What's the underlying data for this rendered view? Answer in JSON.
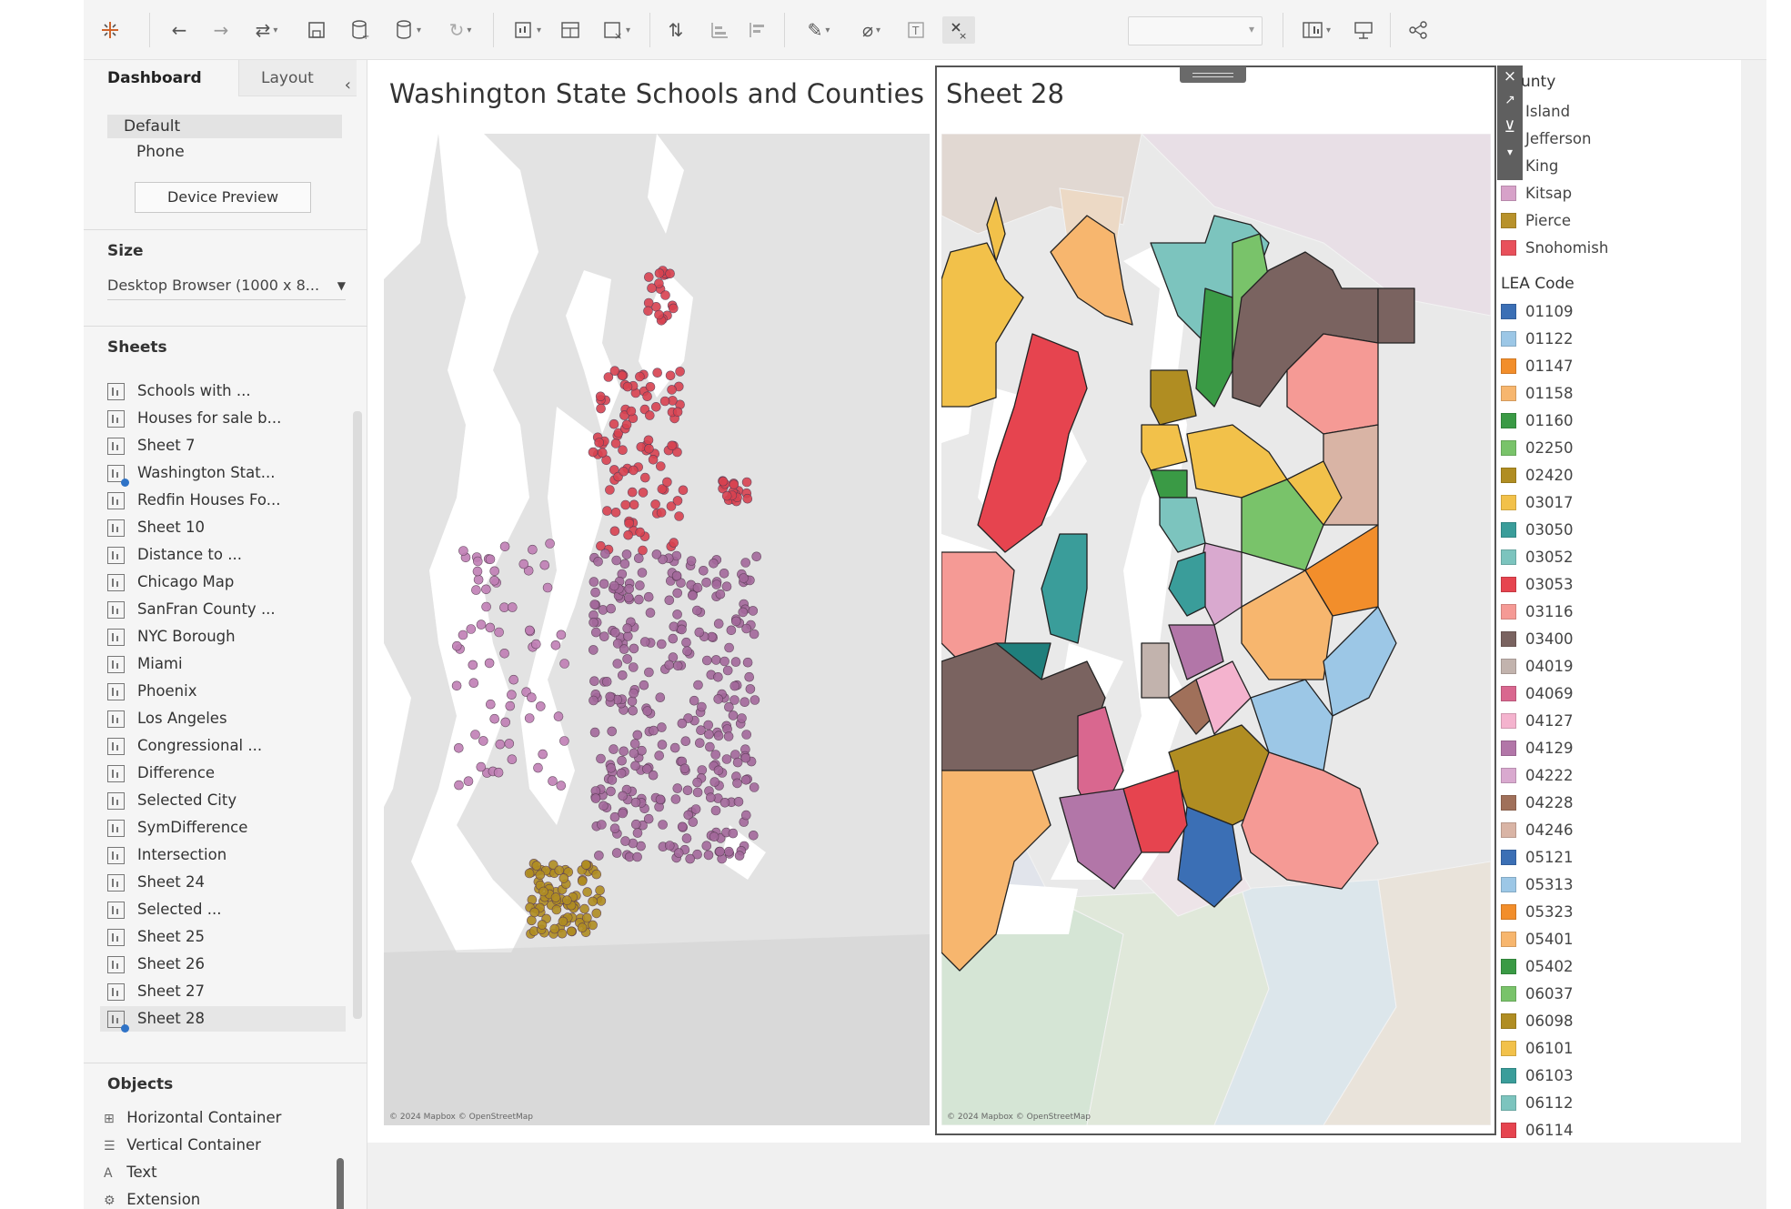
{
  "toolbar": {
    "icons": [
      "tableau-logo-icon",
      "undo-icon",
      "redo-icon",
      "swap-icon",
      "save-icon",
      "new-datasource-icon",
      "pause-updates-icon",
      "refresh-icon",
      "new-worksheet-icon",
      "new-dashboard-icon",
      "clear-sheet-icon",
      "swap-rows-columns-icon",
      "sort-ascending-icon",
      "sort-descending-icon",
      "highlight-icon",
      "group-icon",
      "show-labels-icon",
      "fix-axes-icon",
      "fit-dropdown",
      "show-cards-icon",
      "presentation-mode-icon",
      "share-icon"
    ]
  },
  "left_panel": {
    "tabs": {
      "dashboard": "Dashboard",
      "layout": "Layout"
    },
    "device_layouts": [
      "Default",
      "Phone"
    ],
    "device_preview_label": "Device Preview",
    "size": {
      "title": "Size",
      "value": "Desktop Browser (1000 x 8..."
    },
    "sheets_title": "Sheets",
    "sheets": [
      {
        "label": "Schools with ...",
        "on_dashboard": false
      },
      {
        "label": "Houses for sale b...",
        "on_dashboard": false
      },
      {
        "label": "Sheet 7",
        "on_dashboard": false
      },
      {
        "label": "Washington Stat...",
        "on_dashboard": true
      },
      {
        "label": "Redfin Houses Fo...",
        "on_dashboard": false
      },
      {
        "label": "Sheet 10",
        "on_dashboard": false
      },
      {
        "label": "Distance to ...",
        "on_dashboard": false
      },
      {
        "label": "Chicago Map",
        "on_dashboard": false
      },
      {
        "label": "SanFran County ...",
        "on_dashboard": false
      },
      {
        "label": "NYC Borough",
        "on_dashboard": false
      },
      {
        "label": "Miami",
        "on_dashboard": false
      },
      {
        "label": "Phoenix",
        "on_dashboard": false
      },
      {
        "label": "Los Angeles",
        "on_dashboard": false
      },
      {
        "label": "Congressional ...",
        "on_dashboard": false
      },
      {
        "label": "Difference",
        "on_dashboard": false
      },
      {
        "label": "Selected City",
        "on_dashboard": false
      },
      {
        "label": "SymDifference",
        "on_dashboard": false
      },
      {
        "label": "Intersection",
        "on_dashboard": false
      },
      {
        "label": "Sheet 24",
        "on_dashboard": false
      },
      {
        "label": "Selected ...",
        "on_dashboard": false
      },
      {
        "label": "Sheet 25",
        "on_dashboard": false
      },
      {
        "label": "Sheet 26",
        "on_dashboard": false
      },
      {
        "label": "Sheet 27",
        "on_dashboard": false
      },
      {
        "label": "Sheet 28",
        "on_dashboard": true
      }
    ],
    "objects_title": "Objects",
    "objects": [
      {
        "label": "Horizontal Container",
        "icon": "horizontal-container-icon"
      },
      {
        "label": "Vertical Container",
        "icon": "vertical-container-icon"
      },
      {
        "label": "Text",
        "icon": "text-icon"
      },
      {
        "label": "Extension",
        "icon": "extension-icon"
      }
    ]
  },
  "dashboard": {
    "sheet1_title": "Washington State Schools and Counties",
    "sheet2_title": "Sheet 28",
    "attribution": "© 2024 Mapbox © OpenStreetMap"
  },
  "legend": {
    "county_title": "unty",
    "county": [
      {
        "label": "Island",
        "color": ""
      },
      {
        "label": "Jefferson",
        "color": ""
      },
      {
        "label": "King",
        "color": ""
      },
      {
        "label": "Kitsap",
        "color": "#d7a2c9"
      },
      {
        "label": "Pierce",
        "color": "#b8922b"
      },
      {
        "label": "Snohomish",
        "color": "#e8505b"
      }
    ],
    "lea_title": "LEA Code",
    "lea": [
      {
        "label": "01109",
        "color": "#3b6fb5"
      },
      {
        "label": "01122",
        "color": "#9cc7e6"
      },
      {
        "label": "01147",
        "color": "#f28e2b"
      },
      {
        "label": "01158",
        "color": "#f7b66e"
      },
      {
        "label": "01160",
        "color": "#3a9a45"
      },
      {
        "label": "02250",
        "color": "#79c36a"
      },
      {
        "label": "02420",
        "color": "#b08d22"
      },
      {
        "label": "03017",
        "color": "#f2c14a"
      },
      {
        "label": "03050",
        "color": "#3a9d9a"
      },
      {
        "label": "03052",
        "color": "#7cc4be"
      },
      {
        "label": "03053",
        "color": "#e6444f"
      },
      {
        "label": "03116",
        "color": "#f59a95"
      },
      {
        "label": "03400",
        "color": "#7a6360"
      },
      {
        "label": "04019",
        "color": "#c2b3ad"
      },
      {
        "label": "04069",
        "color": "#d9678f"
      },
      {
        "label": "04127",
        "color": "#f4b3ce"
      },
      {
        "label": "04129",
        "color": "#b276a8"
      },
      {
        "label": "04222",
        "color": "#d9a9cf"
      },
      {
        "label": "04228",
        "color": "#a0705a"
      },
      {
        "label": "04246",
        "color": "#d9b4a5"
      },
      {
        "label": "05121",
        "color": "#3b6fb5"
      },
      {
        "label": "05313",
        "color": "#9cc7e6"
      },
      {
        "label": "05323",
        "color": "#f28e2b"
      },
      {
        "label": "05401",
        "color": "#f7b66e"
      },
      {
        "label": "05402",
        "color": "#3a9a45"
      },
      {
        "label": "06037",
        "color": "#79c36a"
      },
      {
        "label": "06098",
        "color": "#b08d22"
      },
      {
        "label": "06101",
        "color": "#f2c14a"
      },
      {
        "label": "06103",
        "color": "#3a9d9a"
      },
      {
        "label": "06112",
        "color": "#7cc4be"
      },
      {
        "label": "06114",
        "color": "#e6444f"
      }
    ]
  },
  "colors": {
    "snohomish_points": "#d84250",
    "king_points": "#a3689b",
    "kitsap_points": "#c07fb5",
    "pierce_points": "#b08d22"
  }
}
